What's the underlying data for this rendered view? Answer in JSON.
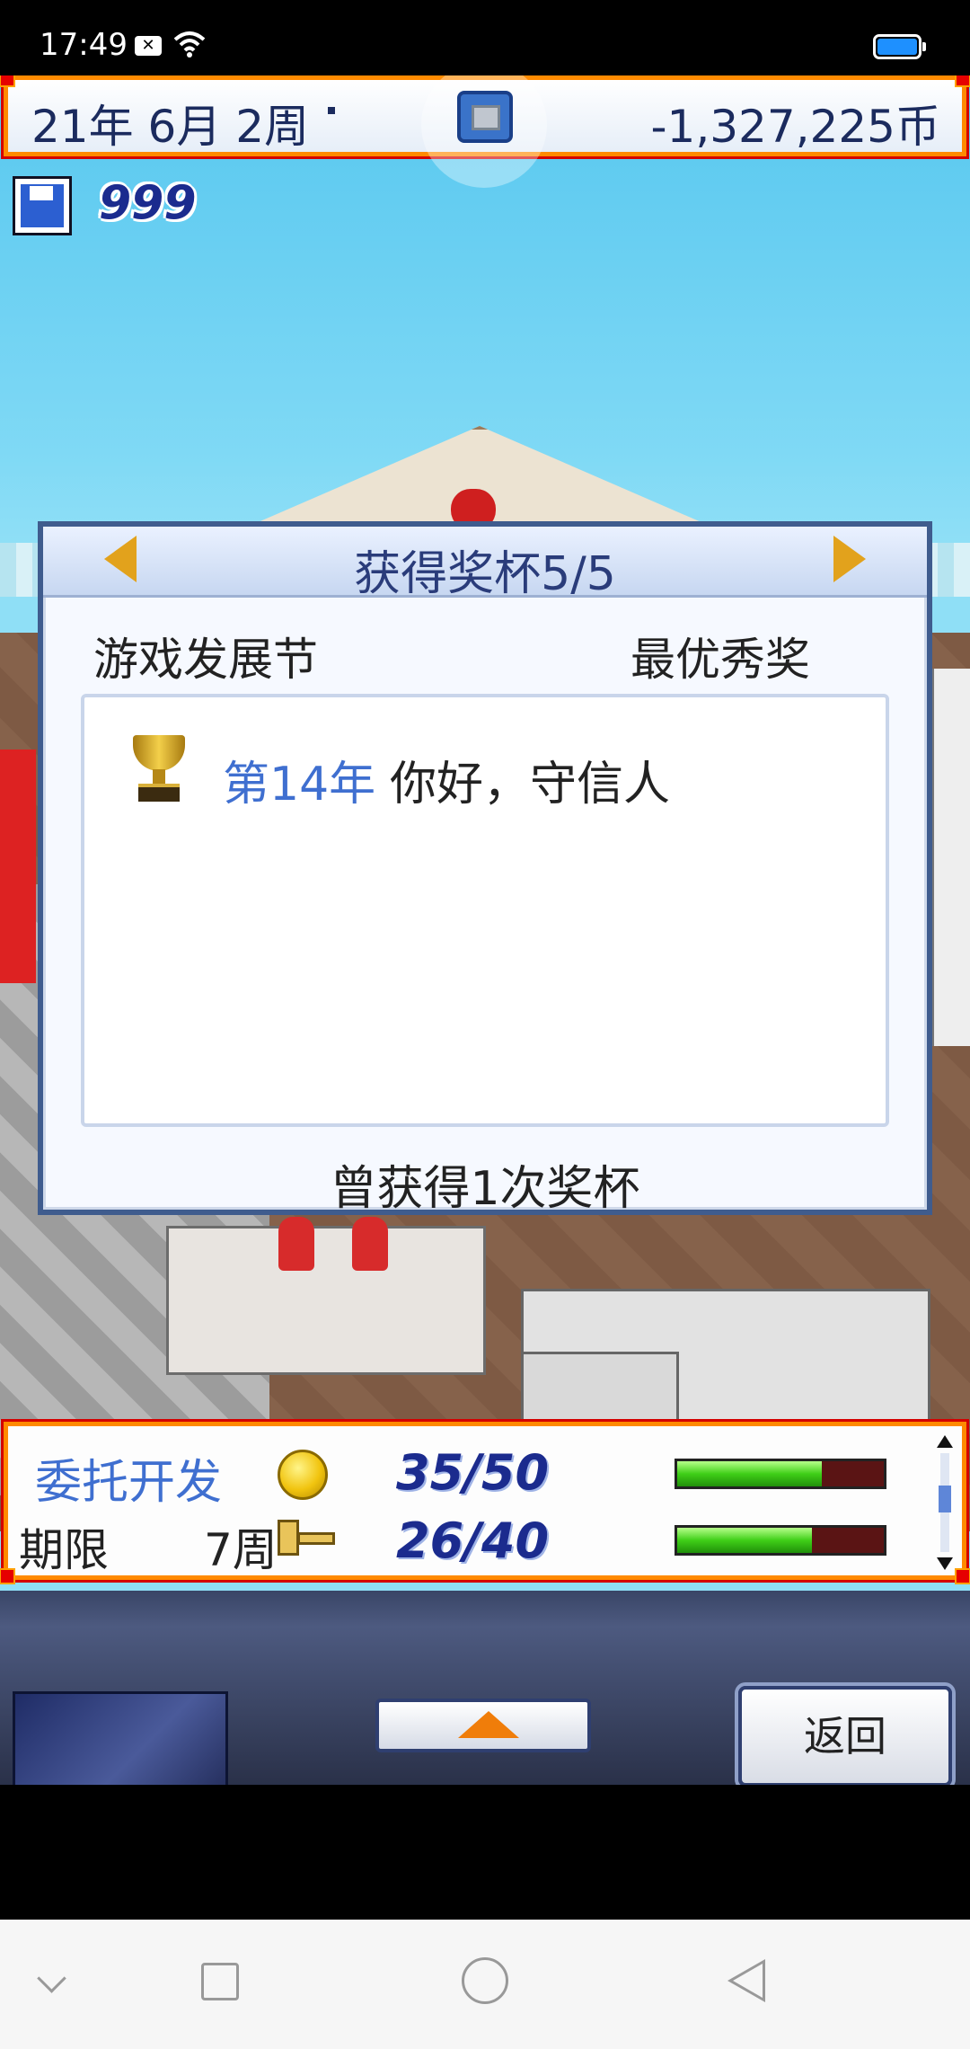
{
  "status_bar": {
    "time": "17:49"
  },
  "top_bar": {
    "date": "21年 6月 2周",
    "money": "-1,327,225币"
  },
  "save": {
    "count": "999"
  },
  "award_dialog": {
    "title": "获得奖杯5/5",
    "event": "游戏发展节",
    "prize": "最优秀奖",
    "entries": [
      {
        "year": "第14年",
        "title": "你好，守信人"
      }
    ],
    "footer": "曾获得1次奖杯"
  },
  "info_panel": {
    "project": "委托开发",
    "deadline_label": "期限",
    "deadline_value": "7周",
    "progress_primary": "35/50",
    "progress_secondary": "26/40",
    "bar_primary_fraction": 0.7,
    "bar_secondary_fraction": 0.65,
    "icons": [
      "coin-icon",
      "key-icon"
    ]
  },
  "controls": {
    "back_label": "返回"
  },
  "colors": {
    "frame_orange": "#ff8a00",
    "frame_red": "#d40000",
    "label_blue": "#3f6fd0",
    "number_navy": "#1b2b8e",
    "bar_green": "#3fcf18"
  }
}
